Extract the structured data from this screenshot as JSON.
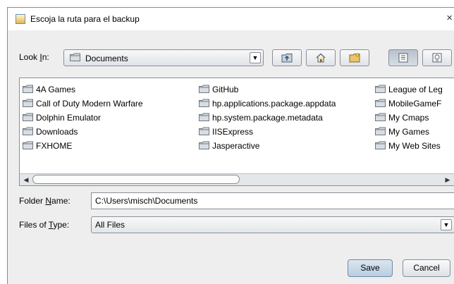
{
  "window": {
    "title": "Escoja la ruta para el backup",
    "close_glyph": "×"
  },
  "look_in": {
    "label_pre": "Look ",
    "label_mnemonic": "I",
    "label_post": "n:",
    "value": "Documents"
  },
  "toolbar": {
    "buttons": [
      {
        "name": "up-one-level-button",
        "icon": "folder-up-icon"
      },
      {
        "name": "home-button",
        "icon": "home-icon"
      },
      {
        "name": "new-folder-button",
        "icon": "new-folder-icon"
      },
      {
        "name": "list-view-button",
        "icon": "list-view-icon",
        "pressed": true
      },
      {
        "name": "details-view-button",
        "icon": "details-view-icon"
      }
    ]
  },
  "files": {
    "col1": [
      "4A Games",
      "Call of Duty Modern Warfare",
      "Dolphin Emulator",
      "Downloads",
      "FXHOME"
    ],
    "col2": [
      "GitHub",
      "hp.applications.package.appdata",
      "hp.system.package.metadata",
      "IISExpress",
      "Jasperactive"
    ],
    "col3": [
      "League of Leg",
      "MobileGameF",
      "My Cmaps",
      "My Games",
      "My Web Sites"
    ]
  },
  "scroll": {
    "left_glyph": "◀",
    "right_glyph": "▶"
  },
  "folder_name": {
    "label_pre": "Folder ",
    "label_mnemonic": "N",
    "label_post": "ame:",
    "value": "C:\\Users\\misch\\Documents"
  },
  "files_of_type": {
    "label_pre": "Files of ",
    "label_mnemonic": "T",
    "label_post": "ype:",
    "value": "All Files"
  },
  "buttons": {
    "save": "Save",
    "cancel": "Cancel"
  },
  "colors": {
    "folder_fill": "#d9dde2",
    "folder_stroke": "#6b7682",
    "accent": "#b9cde0"
  }
}
